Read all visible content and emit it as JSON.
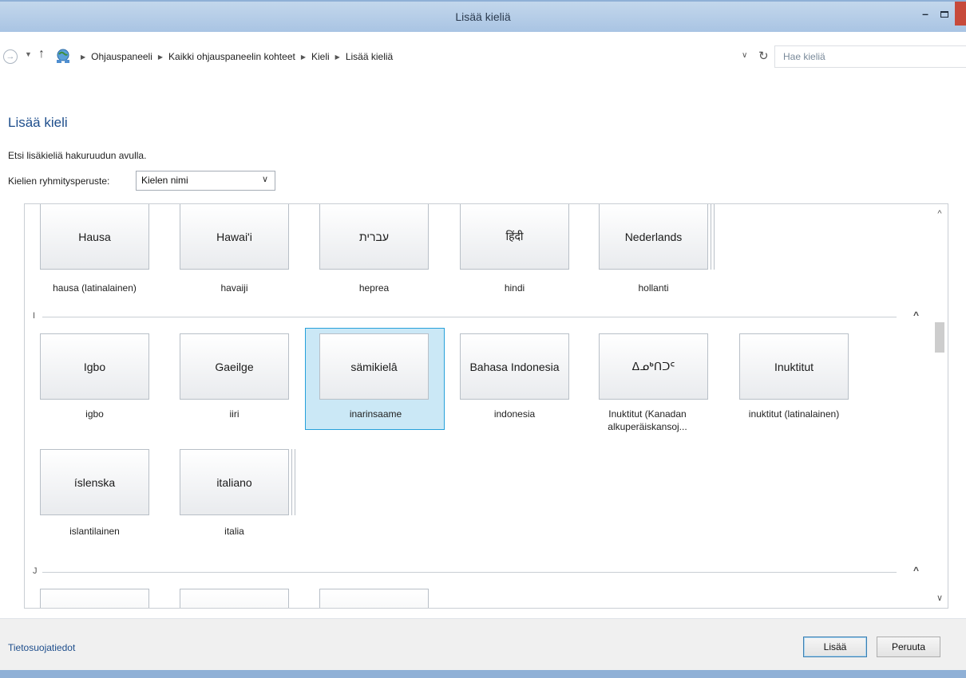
{
  "window": {
    "title": "Lisää kieliä",
    "minimize_label": "–",
    "icons": {
      "back": "back-arrow-icon",
      "up": "up-arrow-icon",
      "control_panel": "control-panel-icon",
      "refresh": "refresh-icon"
    }
  },
  "address_bar": {
    "breadcrumbs": [
      "Ohjauspaneeli",
      "Kaikki ohjauspaneelin kohteet",
      "Kieli",
      "Lisää kieliä"
    ],
    "search_placeholder": "Hae kieliä"
  },
  "main": {
    "title": "Lisää kieli",
    "hint": "Etsi lisäkieliä hakuruudun avulla.",
    "grouping_label": "Kielien ryhmitysperuste:",
    "grouping_value": "Kielen nimi"
  },
  "sections": [
    {
      "letter": "",
      "tiles": [
        {
          "native": "Hausa",
          "name": "hausa (latinalainen)",
          "stack": false
        },
        {
          "native": "Hawai'i",
          "name": "havaiji",
          "stack": false
        },
        {
          "native": "עברית",
          "name": "heprea",
          "stack": false
        },
        {
          "native": "हिंदी",
          "name": "hindi",
          "stack": false
        },
        {
          "native": "Nederlands",
          "name": "hollanti",
          "stack": true
        }
      ]
    },
    {
      "letter": "I",
      "tiles": [
        {
          "native": "Igbo",
          "name": "igbo",
          "stack": false
        },
        {
          "native": "Gaeilge",
          "name": "iiri",
          "stack": false
        },
        {
          "native": "sämikielâ",
          "name": "inarinsaame",
          "stack": false,
          "selected": true
        },
        {
          "native": "Bahasa Indonesia",
          "name": "indonesia",
          "stack": false
        },
        {
          "native": "ᐃᓄᒃᑎᑐᑦ",
          "name": "Inuktitut (Kanadan alkuperäiskansoj...",
          "stack": false
        },
        {
          "native": "Inuktitut",
          "name": "inuktitut (latinalainen)",
          "stack": false
        },
        {
          "native": "íslenska",
          "name": "islantilainen",
          "stack": false
        },
        {
          "native": "italiano",
          "name": "italia",
          "stack": true
        }
      ]
    },
    {
      "letter": "J",
      "tiles": []
    }
  ],
  "footer": {
    "privacy_link": "Tietosuojatiedot",
    "add_button": "Lisää",
    "cancel_button": "Peruuta"
  }
}
